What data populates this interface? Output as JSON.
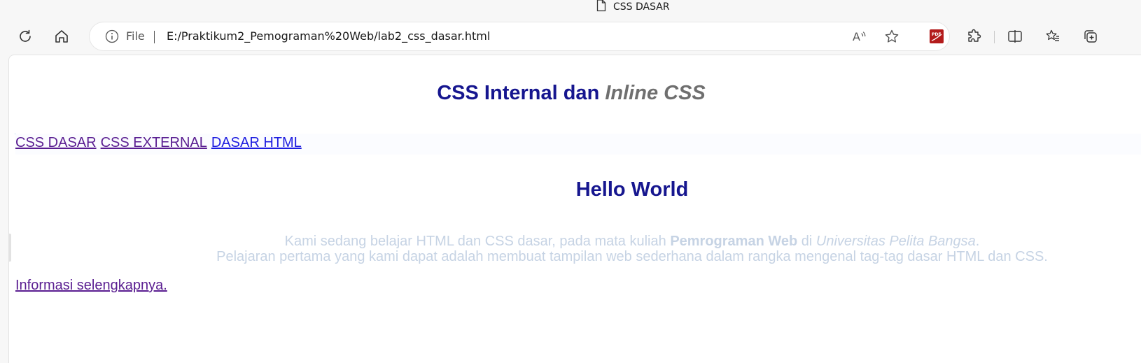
{
  "tab": {
    "title": "CSS DASAR",
    "icon": "file-icon"
  },
  "address_bar": {
    "scheme_label": "File",
    "url": "E:/Praktikum2_Pemograman%20Web/lab2_css_dasar.html"
  },
  "toolbar_icons": [
    "refresh-icon",
    "home-icon",
    "read-aloud-icon",
    "favorite-star-icon",
    "pdf-extension-icon",
    "extensions-icon",
    "split-screen-icon",
    "favorites-icon",
    "collections-icon"
  ],
  "page": {
    "header": {
      "title_main": "CSS Internal dan ",
      "title_inline": "Inline CSS"
    },
    "nav": [
      {
        "label": "CSS DASAR",
        "state": "visited"
      },
      {
        "label": "CSS EXTERNAL",
        "state": "visited"
      },
      {
        "label": "DASAR HTML",
        "state": "unvisited"
      }
    ],
    "hello": "Hello World",
    "paragraph": {
      "line1_a": "Kami sedang belajar HTML dan CSS dasar, pada mata kuliah ",
      "line1_bold": "Pemrograman Web",
      "line1_b": " di ",
      "line1_italic": "Universitas Pelita Bangsa",
      "line1_end": ".",
      "line2": "Pelajaran pertama yang kami dapat adalah membuat tampilan web sederhana dalam rangka mengenal tag-tag dasar HTML dan CSS."
    },
    "more_link": "Informasi selengkapnya."
  },
  "colors": {
    "heading": "#16168f",
    "inline_heading": "#6f6f6f",
    "visited_link": "#5a1e91",
    "unvisited_link": "#1d1de0",
    "paragraph_text": "#c6d3e4",
    "nav_border": "#8fc4e6"
  }
}
